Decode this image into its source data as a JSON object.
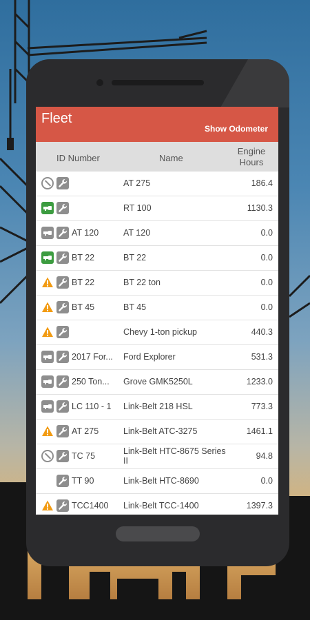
{
  "app": {
    "title": "Fleet",
    "show_odometer_label": "Show Odometer"
  },
  "columns": {
    "id": "ID Number",
    "name": "Name",
    "hours_line1": "Engine",
    "hours_line2": "Hours"
  },
  "colors": {
    "appbar": "#d65746",
    "warning": "#f29b13",
    "key_active": "#3c9c40",
    "key_inactive": "#8e8e8e"
  },
  "rows": [
    {
      "status": "blocked-icon",
      "id": "",
      "name": "AT 275",
      "hours": "186.4"
    },
    {
      "status": "key-green-icon",
      "id": "",
      "name": "RT 100",
      "hours": "1130.3"
    },
    {
      "status": "key-grey-icon",
      "id": "AT 120",
      "name": "AT 120",
      "hours": "0.0"
    },
    {
      "status": "key-green-icon",
      "id": "BT 22",
      "name": "BT 22",
      "hours": "0.0"
    },
    {
      "status": "warning-icon",
      "id": "BT 22",
      "name": "BT 22 ton",
      "hours": "0.0"
    },
    {
      "status": "warning-icon",
      "id": "BT 45",
      "name": "BT 45",
      "hours": "0.0"
    },
    {
      "status": "warning-icon",
      "id": "",
      "name": "Chevy 1-ton pickup",
      "hours": "440.3"
    },
    {
      "status": "key-grey-icon",
      "id": "2017 For...",
      "name": "Ford Explorer",
      "hours": "531.3"
    },
    {
      "status": "key-grey-icon",
      "id": "250 Ton...",
      "name": "Grove GMK5250L",
      "hours": "1233.0"
    },
    {
      "status": "key-grey-icon",
      "id": "LC 110 - 1",
      "name": "Link-Belt 218 HSL",
      "hours": "773.3"
    },
    {
      "status": "warning-icon",
      "id": "AT 275",
      "name": "Link-Belt ATC-3275",
      "hours": "1461.1"
    },
    {
      "status": "blocked-icon",
      "id": "TC 75",
      "name": "Link-Belt HTC-8675 Series II",
      "hours": "94.8"
    },
    {
      "status": "none",
      "id": "TT 90",
      "name": "Link-Belt HTC-8690",
      "hours": "0.0"
    },
    {
      "status": "warning-icon",
      "id": "TCC1400",
      "name": "Link-Belt TCC-1400",
      "hours": "1397.3"
    }
  ]
}
